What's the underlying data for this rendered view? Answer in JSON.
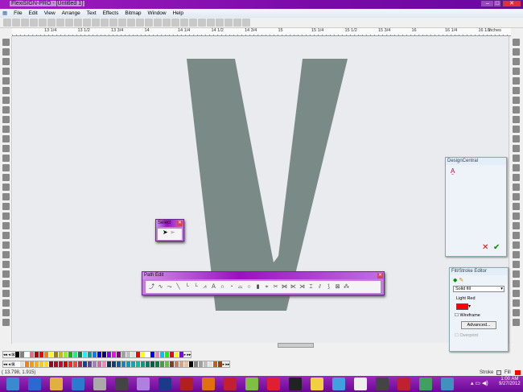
{
  "window": {
    "title": "FlexiSIGN-PRO - [Untitled 1]",
    "minimize": "–",
    "maximize": "□",
    "close": "✕"
  },
  "menu": [
    "File",
    "Edit",
    "View",
    "Arrange",
    "Text",
    "Effects",
    "Bitmap",
    "Window",
    "Help"
  ],
  "ruler": {
    "labels": [
      "13 1/4",
      "13 1/2",
      "13 3/4",
      "14",
      "14 1/4",
      "14 1/2",
      "14 3/4",
      "15",
      "15 1/4",
      "15 1/2",
      "15 3/4",
      "16",
      "16 1/4",
      "16 1/2"
    ],
    "units": "inches"
  },
  "canvas": {
    "glyph": "V",
    "glyph_color": "#7a8a86"
  },
  "select_toolbar": {
    "title": "Select"
  },
  "path_edit_toolbar": {
    "title": "Path Edit"
  },
  "design_central": {
    "title": "DesignCentral",
    "cancel": "✕",
    "ok": "✔"
  },
  "fill_stroke": {
    "title": "Fill/Stroke Editor",
    "fill_type": "Solid fill",
    "color_name": "Light Red",
    "color": "#ff0000",
    "wireframe_label": "Wireframe",
    "wireframe_checked": false,
    "advanced_label": "Advanced...",
    "overprint_label": "Overprint",
    "overprint_checked": false
  },
  "palette1": [
    "#000000",
    "#808080",
    "#ffffff",
    "#ff6080",
    "#c00000",
    "#ff0000",
    "#ff8000",
    "#ffff00",
    "#a08000",
    "#c0c000",
    "#80ff00",
    "#00c000",
    "#00ff80",
    "#008040",
    "#00ffff",
    "#00a0a0",
    "#0080ff",
    "#0000ff",
    "#000080",
    "#8000ff",
    "#ff00ff",
    "#800080",
    "#a0a0a0",
    "#c0c0c0",
    "#e0e0e0",
    "#ff0000",
    "#ffff00",
    "#ffffff",
    "#0000ff",
    "#ff80c0",
    "#00c0ff",
    "#00ff00",
    "#ff0000",
    "#ffff00",
    "#8000ff"
  ],
  "palette2": [
    "#ffffff",
    "#e0e0e0",
    "#ff8000",
    "#ff9900",
    "#ffb000",
    "#ffcc00",
    "#ffe000",
    "#a00020",
    "#c00020",
    "#d00030",
    "#e00000",
    "#ff2020",
    "#ff4040",
    "#c02040",
    "#1040a0",
    "#6040a0",
    "#a080c0",
    "#e060a0",
    "#ff80c0",
    "#103060",
    "#104080",
    "#1060a0",
    "#2080c0",
    "#00a0c0",
    "#00b0b0",
    "#00c0a0",
    "#00a080",
    "#008060",
    "#006040",
    "#008040",
    "#40a040",
    "#60c040",
    "#804020",
    "#c08060",
    "#e0a080",
    "#f0c090",
    "#000000",
    "#808080",
    "#a0a0a0",
    "#c0c0c0",
    "#e0e0e0",
    "#c06020",
    "#a04000"
  ],
  "status": {
    "coords": "( 13.798,   1.915)",
    "stroke_label": "Stroke",
    "fill_label": "Fill"
  },
  "tray": {
    "time": "1:00 AM",
    "date": "9/27/2012"
  }
}
